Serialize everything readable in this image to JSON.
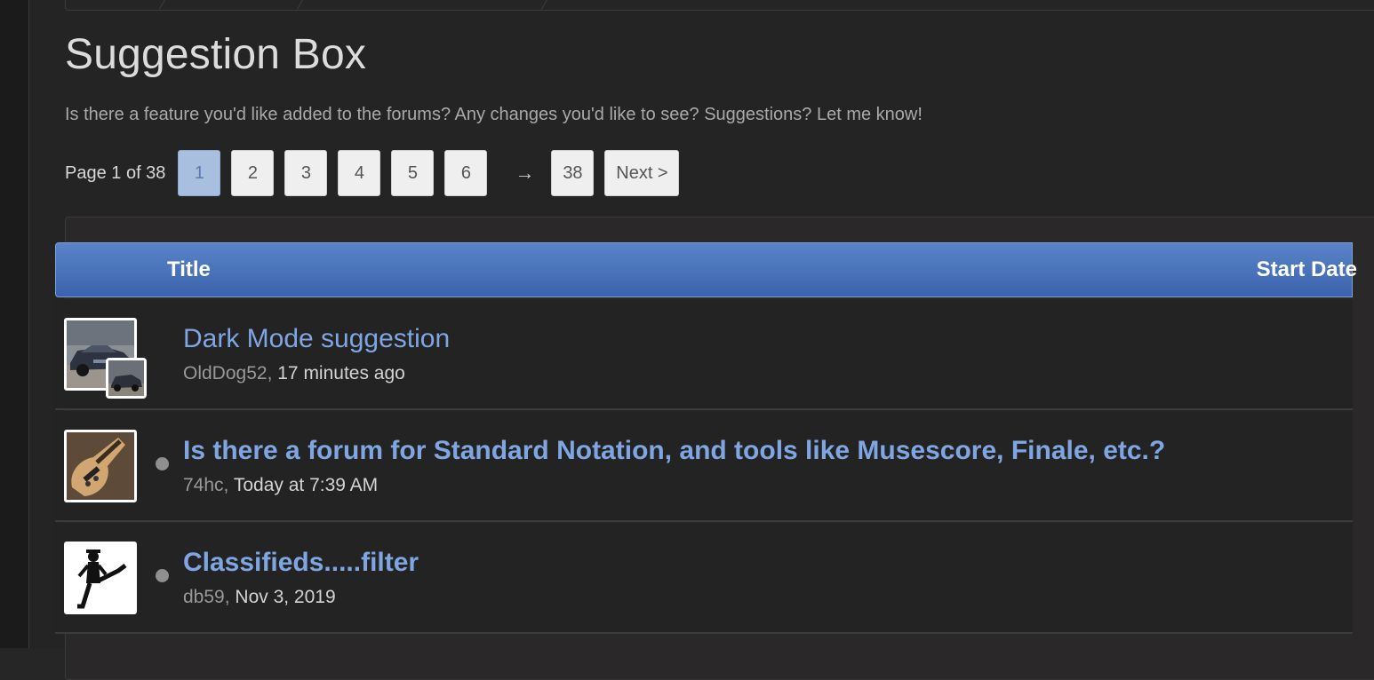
{
  "forum": {
    "title": "Suggestion Box",
    "description": "Is there a feature you'd like added to the forums? Any changes you'd like to see? Suggestions? Let me know!"
  },
  "pagination": {
    "info": "Page 1 of 38",
    "pages": [
      "1",
      "2",
      "3",
      "4",
      "5",
      "6"
    ],
    "current": "1",
    "arrow": "→",
    "last": "38",
    "next": "Next >"
  },
  "list_header": {
    "title": "Title",
    "start_date": "Start Date"
  },
  "threads": [
    {
      "title": "Dark Mode suggestion",
      "author": "OldDog52",
      "date": "17 minutes ago",
      "unread": false,
      "avatar": "car-photo-avatar"
    },
    {
      "title": "Is there a forum for Standard Notation, and tools like Musescore, Finale, etc.?",
      "author": "74hc",
      "date": "Today at 7:39 AM",
      "unread": true,
      "avatar": "bass-guitar-avatar"
    },
    {
      "title": "Classifieds.....filter",
      "author": "db59",
      "date": "Nov 3, 2019",
      "unread": true,
      "avatar": "silly-walk-avatar"
    }
  ],
  "meta_separator": ",",
  "colors": {
    "background": "#242424",
    "header_gradient_top": "#5a84c8",
    "header_gradient_bottom": "#3a63ad",
    "link": "#7fa6e2",
    "current_page": "#a9bfe0"
  }
}
